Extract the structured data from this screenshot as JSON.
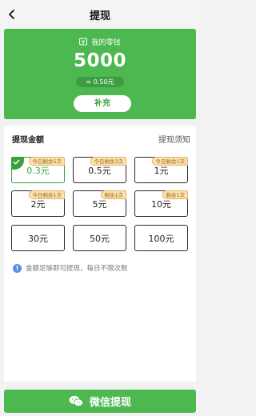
{
  "header": {
    "title": "提现",
    "back_icon": "chevron-left-icon"
  },
  "wallet": {
    "icon": "wallet-icon",
    "label": "我的零钱",
    "balance": "5000",
    "approx": "≈ 0.50元",
    "topup_label": "补充",
    "background": "#4db84f"
  },
  "panel": {
    "amount_title": "提现金额",
    "notice_link": "提现须知",
    "options": [
      {
        "amount": "0.3元",
        "tag": "今日剩余5次",
        "selected": true
      },
      {
        "amount": "0.5元",
        "tag": "今日剩余3次",
        "selected": false
      },
      {
        "amount": "1元",
        "tag": "今日剩余1次",
        "selected": false
      },
      {
        "amount": "2元",
        "tag": "今日剩余1次",
        "selected": false
      },
      {
        "amount": "5元",
        "tag": "剩余1次",
        "selected": false
      },
      {
        "amount": "10元",
        "tag": "剩余1次",
        "selected": false
      },
      {
        "amount": "30元",
        "tag": "",
        "selected": false
      },
      {
        "amount": "50元",
        "tag": "",
        "selected": false
      },
      {
        "amount": "100元",
        "tag": "",
        "selected": false
      }
    ],
    "note": "金额足够即可提现，每日不限次数",
    "note_icon": "info-icon"
  },
  "footer": {
    "wechat_label": "微信提现",
    "wechat_icon": "wechat-icon",
    "accent": "#37a13a"
  }
}
